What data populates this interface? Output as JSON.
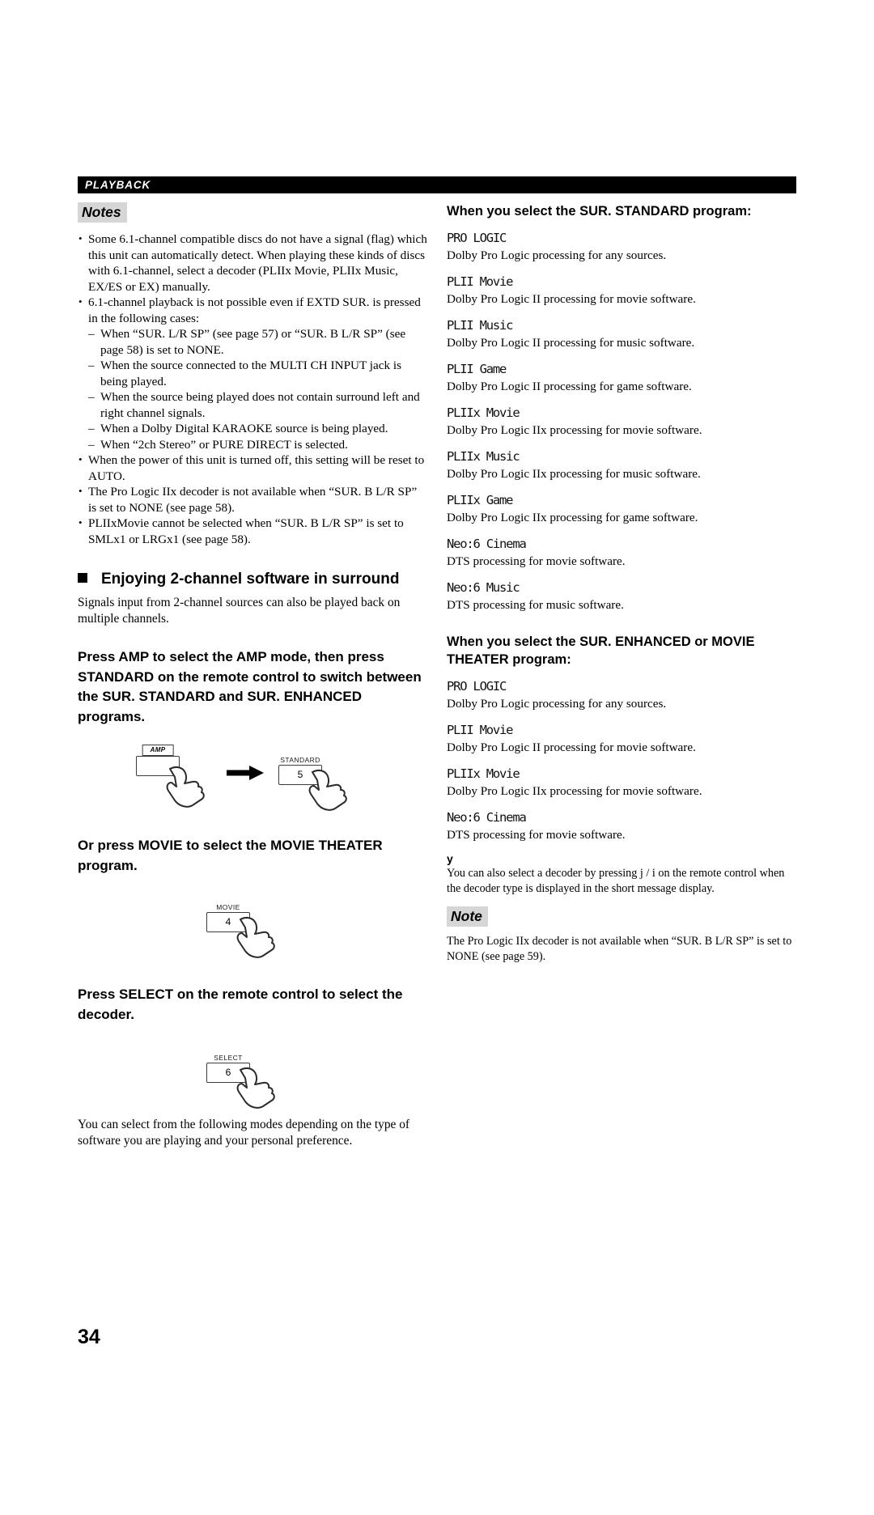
{
  "header": {
    "running_title": "PLAYBACK"
  },
  "page_number": "34",
  "left_column": {
    "notes_tag": "Notes",
    "notes": [
      {
        "text": "Some 6.1-channel compatible discs do not have a signal (flag) which this unit can automatically detect. When playing these kinds of discs with 6.1-channel, select a decoder (PLIIx Movie, PLIIx Music, EX/ES or EX) manually."
      },
      {
        "text": "6.1-channel playback is not possible even if EXTD SUR. is pressed in the following cases:",
        "subitems": [
          "When “SUR. L/R SP” (see page 57) or “SUR. B L/R SP” (see page 58) is set to NONE.",
          "When the source connected to the MULTI CH INPUT jack is being played.",
          "When the source being played does not contain surround left and right channel signals.",
          "When a Dolby Digital KARAOKE source is being played.",
          "When “2ch Stereo” or PURE DIRECT is selected."
        ]
      },
      {
        "text": "When the power of this unit is turned off, this setting will be reset to AUTO."
      },
      {
        "text": "The Pro Logic IIx decoder is not available when “SUR. B L/R SP” is set to NONE (see page 58)."
      },
      {
        "text": "PLIIxMovie cannot be selected when “SUR. B L/R SP” is set to SMLx1 or LRGx1 (see page 58)."
      }
    ],
    "section_heading": "Enjoying 2-channel software in surround",
    "section_intro": "Signals input from 2-channel sources can also be played back on multiple channels.",
    "step1_heading": "Press AMP to select the AMP mode, then press STANDARD on the remote control to switch between the SUR. STANDARD and SUR. ENHANCED programs.",
    "step1_key1_caption": "AMP",
    "step1_key1_value": "",
    "step1_key2_caption": "STANDARD",
    "step1_key2_value": "5",
    "step2_heading": "Or press MOVIE to select the MOVIE THEATER program.",
    "step2_key_caption": "MOVIE",
    "step2_key_value": "4",
    "step3_heading": "Press SELECT on the remote control to select the decoder.",
    "step3_key_caption": "SELECT",
    "step3_key_value": "6",
    "closing_paragraph": "You can select from the following modes depending on the type of software you are playing and your personal preference."
  },
  "right_column": {
    "standard_heading": "When you select the SUR. STANDARD program:",
    "standard_decoders": [
      {
        "name": "PRO LOGIC",
        "desc": "Dolby Pro Logic processing for any sources."
      },
      {
        "name": "PLII Movie",
        "desc": "Dolby Pro Logic II processing for movie software."
      },
      {
        "name": "PLII Music",
        "desc": "Dolby Pro Logic II processing for music software."
      },
      {
        "name": "PLII Game",
        "desc": "Dolby Pro Logic II processing for game software."
      },
      {
        "name": "PLIIx Movie",
        "desc": "Dolby Pro Logic IIx processing for movie software."
      },
      {
        "name": "PLIIx Music",
        "desc": "Dolby Pro Logic IIx processing for music software."
      },
      {
        "name": "PLIIx Game",
        "desc": "Dolby Pro Logic IIx processing for game software."
      },
      {
        "name": "Neo:6 Cinema",
        "desc": "DTS processing for movie software."
      },
      {
        "name": "Neo:6 Music",
        "desc": "DTS processing for music software."
      }
    ],
    "enhanced_heading": "When you select the SUR. ENHANCED or MOVIE THEATER program:",
    "enhanced_decoders": [
      {
        "name": "PRO LOGIC",
        "desc": "Dolby Pro Logic processing for any sources."
      },
      {
        "name": "PLII Movie",
        "desc": "Dolby Pro Logic II processing for movie software."
      },
      {
        "name": "PLIIx Movie",
        "desc": "Dolby Pro Logic IIx processing for movie software."
      },
      {
        "name": "Neo:6 Cinema",
        "desc": "DTS processing for movie software."
      }
    ],
    "tip_glyph": "y",
    "tip_text": "You can also select a decoder by pressing j / i on the remote control when the decoder type is displayed in the short message display.",
    "note_tag": "Note",
    "note_text": "The Pro Logic IIx decoder is not available when “SUR. B L/R SP” is set to NONE (see page 59)."
  },
  "colors": {
    "header_bar": "#000000",
    "tag_background": "#d6d6d6",
    "text": "#000000"
  }
}
